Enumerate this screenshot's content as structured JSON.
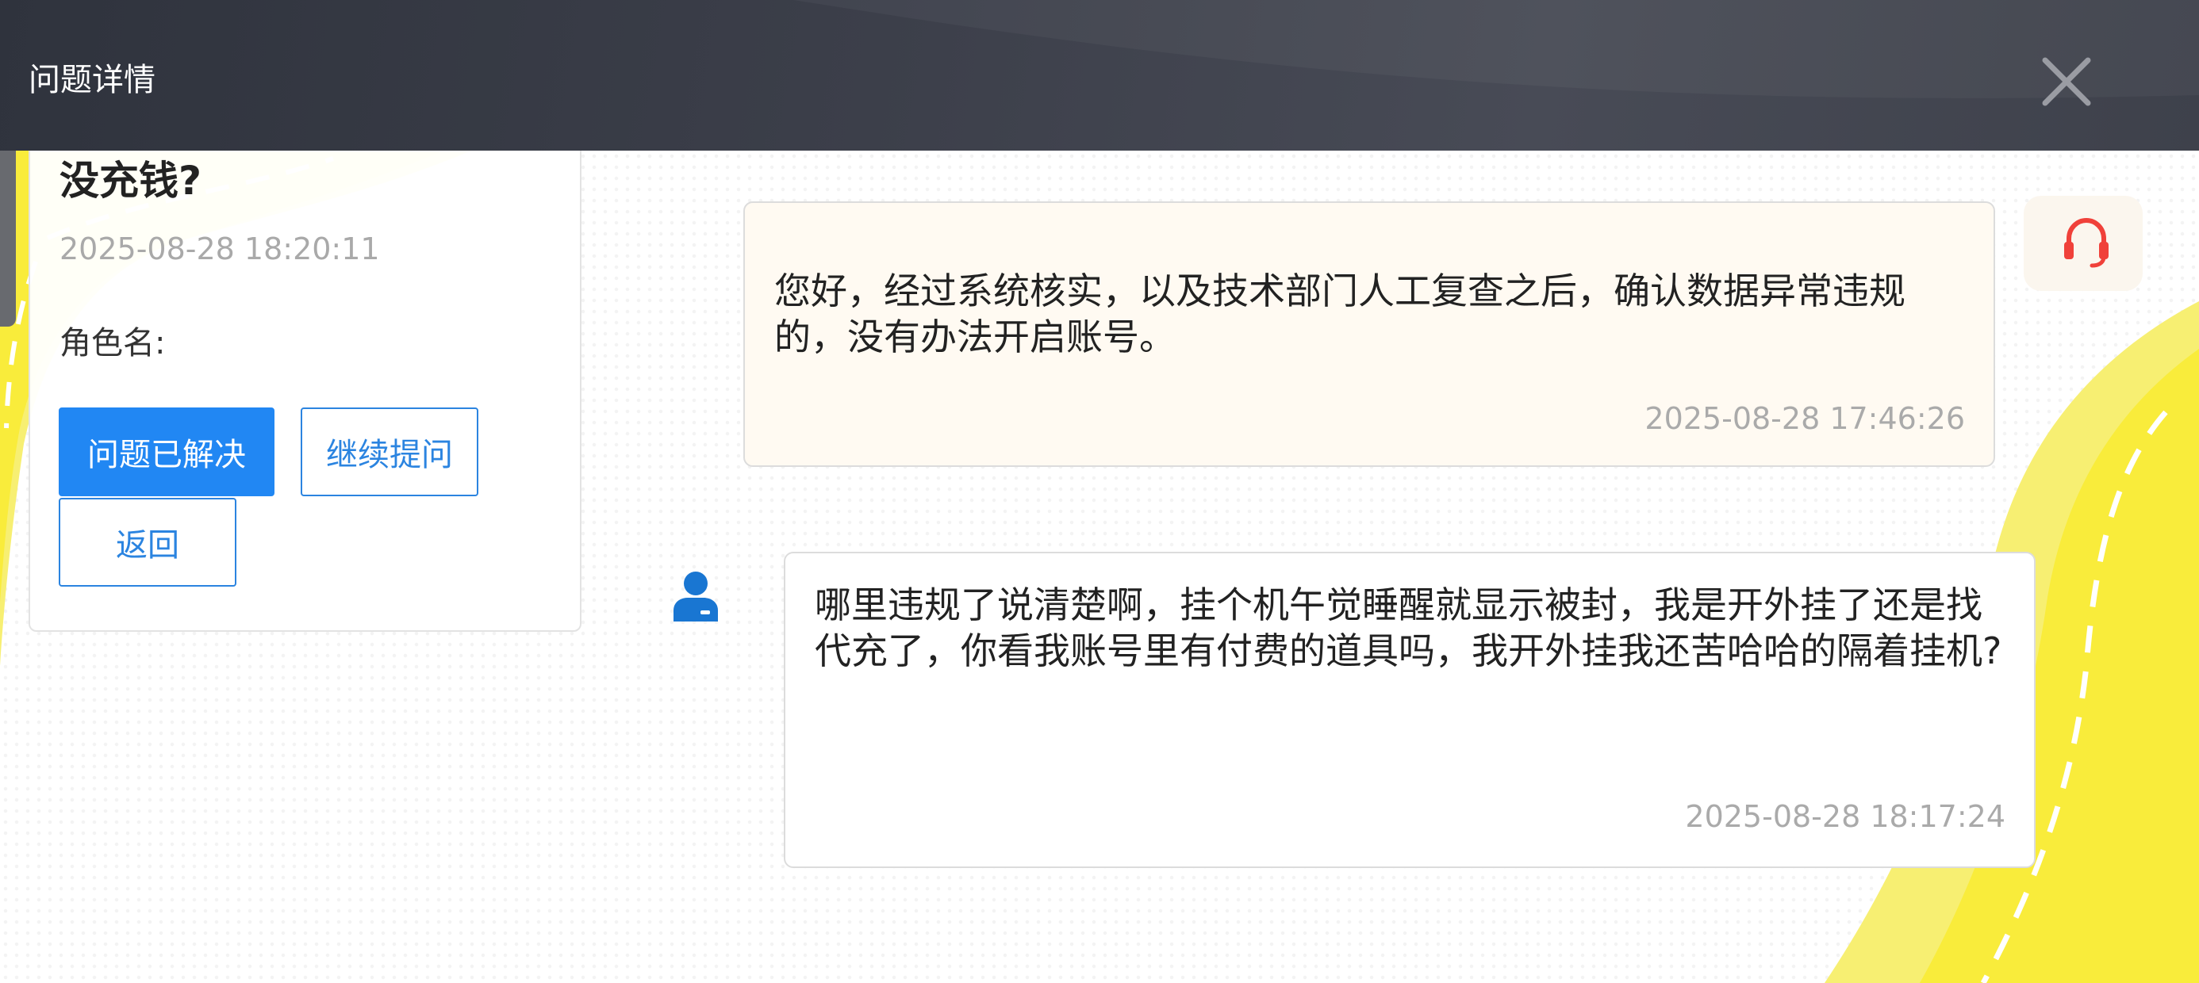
{
  "header": {
    "title": "问题详情",
    "close_icon": "close-icon"
  },
  "info_panel": {
    "heading": "没充钱?",
    "date": "2025-08-28 18:20:11",
    "role_label": "角色名:",
    "buttons": {
      "resolved": "问题已解决",
      "continue": "继续提问",
      "back": "返回"
    }
  },
  "messages": [
    {
      "sender": "agent",
      "avatar_icon": "headset-icon",
      "text": "您好，经过系统核实，以及技术部门人工复查之后，确认数据异常违规的，没有办法开启账号。",
      "time": "2025-08-28 17:46:26"
    },
    {
      "sender": "user",
      "avatar_icon": "user-icon",
      "text": "哪里违规了说清楚啊，挂个机午觉睡醒就显示被封，我是开外挂了还是找代充了，你看我账号里有付费的道具吗，我开外挂我还苦哈哈的隔着挂机?",
      "time": "2025-08-28 18:17:24"
    }
  ],
  "colors": {
    "header_bg": "#3c3f4a",
    "primary_blue": "#2187f3",
    "accent_yellow": "#f9ec3b",
    "agent_icon_red": "#f0413a"
  }
}
